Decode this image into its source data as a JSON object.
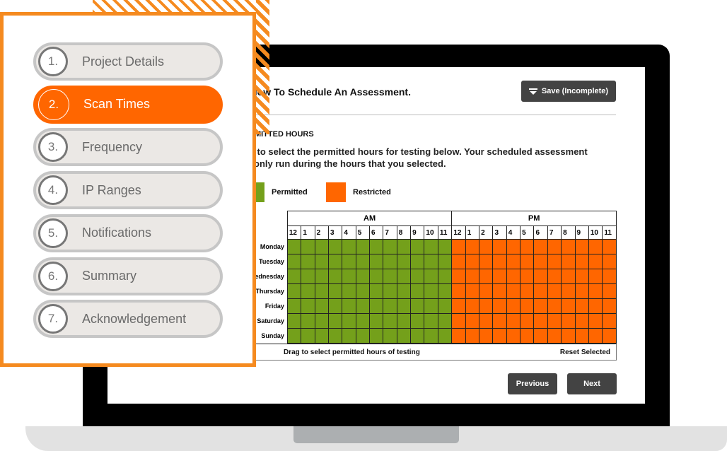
{
  "steps": [
    {
      "number": "1.",
      "label": "Project Details",
      "active": false
    },
    {
      "number": "2.",
      "label": "Scan Times",
      "active": true
    },
    {
      "number": "3.",
      "label": "Frequency",
      "active": false
    },
    {
      "number": "4.",
      "label": "IP Ranges",
      "active": false
    },
    {
      "number": "5.",
      "label": "Notifications",
      "active": false
    },
    {
      "number": "6.",
      "label": "Summary",
      "active": false
    },
    {
      "number": "7.",
      "label": "Acknowledgement",
      "active": false
    }
  ],
  "screen": {
    "heading": "elow To Schedule An Assessment.",
    "save_button": {
      "icon": "save-download-icon",
      "label": "Save (Incomplete)"
    },
    "section_title": "RMITTED HOURS",
    "description_line1": "g to select the permitted hours for testing below. Your scheduled assessment",
    "description_line2": "only run during the hours that you selected.",
    "legend": [
      {
        "label": "Permitted",
        "color": "#74a01b"
      },
      {
        "label": "Restricted",
        "color": "#ff6600"
      }
    ],
    "grid": {
      "am_label": "AM",
      "pm_label": "PM",
      "hours": [
        "12",
        "1",
        "2",
        "3",
        "4",
        "5",
        "6",
        "7",
        "8",
        "9",
        "10",
        "11"
      ],
      "days": [
        "Monday",
        "Tuesday",
        "Wednesday",
        "Thursday",
        "Friday",
        "Saturday",
        "Sunday"
      ],
      "am_state": "permitted",
      "pm_state": "restricted",
      "footer_hint": "Drag to select permitted hours of testing",
      "reset_label": "Reset Selected"
    },
    "previous_label": "Previous",
    "next_label": "Next"
  },
  "colors": {
    "accent": "#ff6600",
    "frame_orange": "#f58a1f",
    "permitted": "#74a01b",
    "restricted": "#ff6600",
    "button_dark": "#434343"
  }
}
